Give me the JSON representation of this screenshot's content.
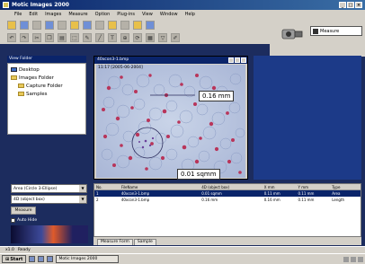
{
  "window": {
    "title": "Motic Images 2000"
  },
  "menu": [
    "File",
    "Edit",
    "Images",
    "Measure",
    "Option",
    "Plug-ins",
    "View",
    "Window",
    "Help"
  ],
  "measure_button": {
    "label": "Measure"
  },
  "folders": {
    "panel_title": "View Folder",
    "items": [
      {
        "label": "Desktop",
        "icon": "desktop-icon",
        "indent": 0
      },
      {
        "label": "Images Folder",
        "icon": "folder-icon",
        "indent": 0
      },
      {
        "label": "Capture Folder",
        "icon": "folder-icon",
        "indent": 1
      },
      {
        "label": "Samples",
        "icon": "folder-icon",
        "indent": 1
      }
    ]
  },
  "image_window": {
    "title": "40xcon3-1.bmp",
    "timestamp": "11:17 [2005-06-2004]",
    "measurements": [
      "0.16 mm",
      "0.01 sqmm"
    ]
  },
  "controls": {
    "shape_dropdown": "Area (Circle 3-Ellipse)",
    "object_dropdown": "4D (object box)",
    "measure_label": "Measure",
    "autohide_label": "Auto Hide"
  },
  "table": {
    "headers": [
      "No.",
      "FileName",
      "4D (object box)",
      "X mm",
      "Y mm",
      "Type"
    ],
    "rows": [
      [
        "1",
        "40xcon3-1.bmp",
        "0.01 sqmm",
        "0.11 mm",
        "0.11 mm",
        "Area"
      ],
      [
        "2",
        "40xcon3-1.bmp",
        "0.16 mm",
        "0.16 mm",
        "0.11 mm",
        "Length"
      ]
    ]
  },
  "tabs": [
    "Measure Form",
    "Sample"
  ],
  "status": {
    "zoom": "x1.0",
    "label": "Ready"
  },
  "taskbar": {
    "start_label": "Start",
    "active_app": "Motic Images 2000"
  },
  "colors": {
    "titlebar": "#0a246a",
    "desktop": "#1c2c5e",
    "chrome": "#d4d0c8"
  }
}
